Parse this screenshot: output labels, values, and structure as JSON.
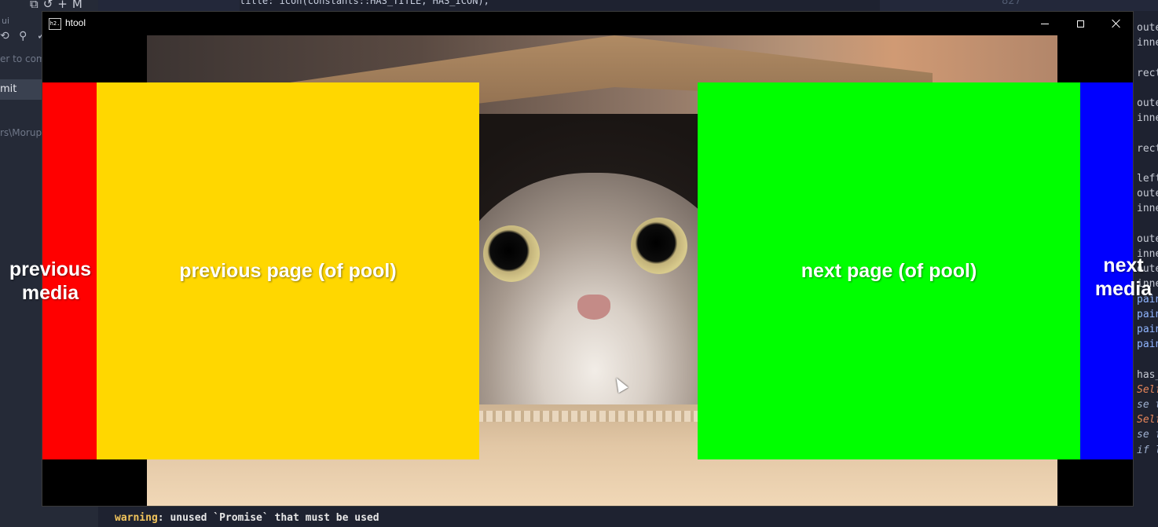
{
  "window": {
    "title": "htool",
    "app_icon_text": "h2.",
    "colors": {
      "titlebar": "#000000",
      "background": "#000000"
    }
  },
  "zones": {
    "previous_media": {
      "label": "previous media",
      "color": "#ff0000"
    },
    "previous_page": {
      "label": "previous page (of pool)",
      "color": "#ffd700"
    },
    "next_page": {
      "label": "next page (of pool)",
      "color": "#00ff00"
    },
    "next_media": {
      "label": "next media",
      "color": "#0000ff"
    }
  },
  "background_ide": {
    "left_panel": {
      "repo_label": "ui",
      "filter_placeholder": "er to com",
      "commit_button": "mit",
      "path_text": "rs\\Moruph"
    },
    "code_top_line": "title: icon(constants::HAS_TITLE, HAS_ICON),",
    "top_right_number": "827",
    "right_code_lines": [
      "oute",
      "inne",
      "",
      "rect",
      "",
      "oute",
      "inne",
      "",
      "rect",
      "",
      "left",
      "oute",
      "inne",
      "",
      "oute",
      "inne",
      "oute",
      "inne",
      "paint",
      "paint",
      "paint",
      "paint",
      "",
      "has_r",
      "Self",
      "se t",
      "Self",
      "se f",
      "if l"
    ],
    "terminal": {
      "warning_label": "warning",
      "message": ": unused `Promise` that must be used"
    }
  }
}
